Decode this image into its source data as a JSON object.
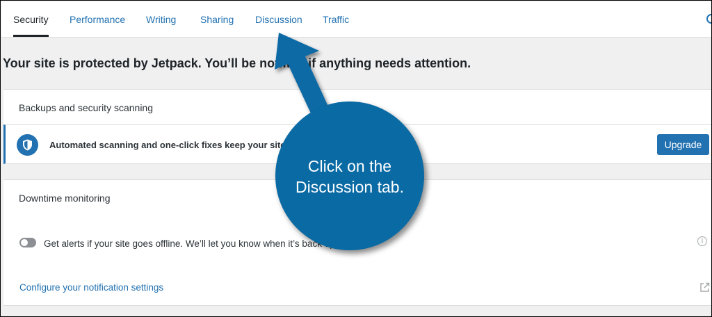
{
  "tabs": [
    {
      "label": "Security",
      "active": true
    },
    {
      "label": "Performance"
    },
    {
      "label": "Writing"
    },
    {
      "label": "Sharing"
    },
    {
      "label": "Discussion"
    },
    {
      "label": "Traffic"
    }
  ],
  "headline": "Your site is protected by Jetpack. You’ll be notified if anything needs attention.",
  "backups": {
    "header": "Backups and security scanning",
    "banner_text": "Automated scanning and one-click fixes keep your site ahead of security threats.",
    "upgrade_label": "Upgrade"
  },
  "downtime": {
    "header": "Downtime monitoring",
    "toggle_label": "Get alerts if your site goes offline. We’ll let you know when it’s back up, too.",
    "config_link": "Configure your notification settings"
  },
  "callout": {
    "line1": "Click on the",
    "line2": "Discussion tab."
  },
  "colors": {
    "accent": "#2271b1",
    "callout": "#0a6aa4"
  }
}
